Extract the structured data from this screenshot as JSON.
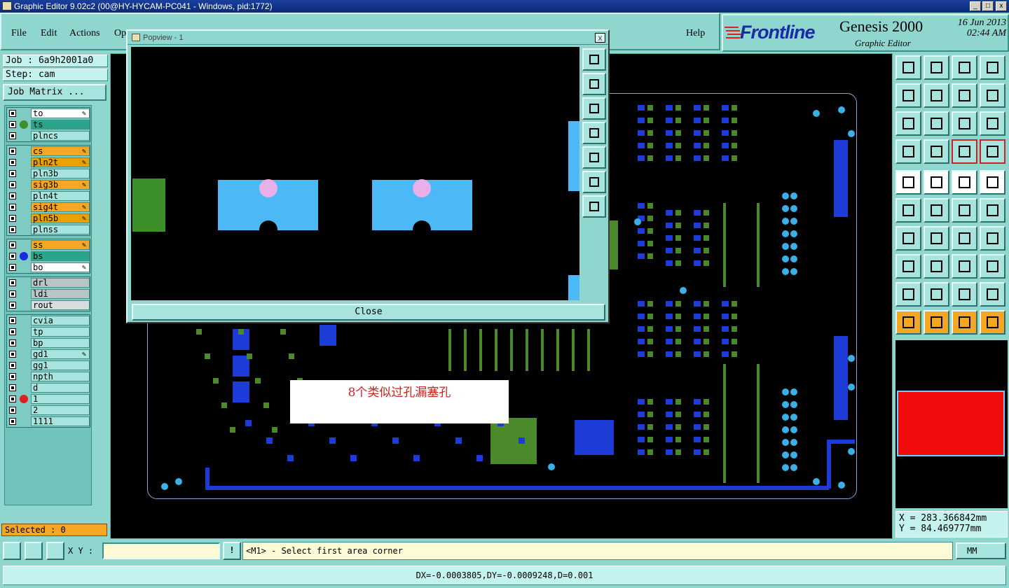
{
  "window": {
    "title": "Graphic Editor 9.02c2 (00@HY-HYCAM-PC041 - Windows, pid:1772)"
  },
  "menu": {
    "file": "File",
    "edit": "Edit",
    "actions": "Actions",
    "options": "Op",
    "help": "Help"
  },
  "brand": {
    "logo": "Frontline",
    "product": "Genesis 2000",
    "module": "Graphic Editor",
    "date": "16 Jun 2013",
    "time": "02:44 AM"
  },
  "job": {
    "job_line": "Job : 6a9h2001a0",
    "step_line": "Step: cam",
    "matrix_button": "Job Matrix ..."
  },
  "layers": [
    [
      {
        "name": "to",
        "color": "#ffffff",
        "dot": "",
        "pen": true
      },
      {
        "name": "ts",
        "color": "#2aa58a",
        "dot": "#3d8f2a",
        "pen": false
      },
      {
        "name": "plncs",
        "color": "#a7e4dd",
        "dot": "",
        "pen": false
      }
    ],
    [
      {
        "name": "cs",
        "color": "#f5a623",
        "dot": "",
        "pen": true
      },
      {
        "name": "pln2t",
        "color": "#e8a100",
        "dot": "",
        "pen": true
      },
      {
        "name": "pln3b",
        "color": "#a7e4dd",
        "dot": "",
        "pen": false
      },
      {
        "name": "sig3b",
        "color": "#f5a623",
        "dot": "",
        "pen": true
      },
      {
        "name": "pln4t",
        "color": "#a7e4dd",
        "dot": "",
        "pen": false
      },
      {
        "name": "sig4t",
        "color": "#f5a623",
        "dot": "",
        "pen": true
      },
      {
        "name": "pln5b",
        "color": "#e8a100",
        "dot": "",
        "pen": true
      },
      {
        "name": "plnss",
        "color": "#a7e4dd",
        "dot": "",
        "pen": false
      }
    ],
    [
      {
        "name": "ss",
        "color": "#f5a623",
        "dot": "",
        "pen": true
      },
      {
        "name": "bs",
        "color": "#2aa58a",
        "dot": "#1a2ae0",
        "pen": false
      },
      {
        "name": "bo",
        "color": "#ffffff",
        "dot": "",
        "pen": true
      }
    ],
    [
      {
        "name": "drl",
        "color": "#b9c4c6",
        "dot": "",
        "pen": false
      },
      {
        "name": "ldi",
        "color": "#b9c4c6",
        "dot": "",
        "pen": false
      },
      {
        "name": "rout",
        "color": "#d7dcdc",
        "dot": "",
        "pen": false
      }
    ],
    [
      {
        "name": "cvia",
        "color": "#a7e4dd",
        "dot": "",
        "pen": false
      },
      {
        "name": "tp",
        "color": "#a7e4dd",
        "dot": "",
        "pen": false
      },
      {
        "name": "bp",
        "color": "#a7e4dd",
        "dot": "",
        "pen": false
      },
      {
        "name": "gd1",
        "color": "#a7e4dd",
        "dot": "",
        "pen": true
      },
      {
        "name": "gg1",
        "color": "#a7e4dd",
        "dot": "",
        "pen": false
      },
      {
        "name": "npth",
        "color": "#a7e4dd",
        "dot": "",
        "pen": false
      },
      {
        "name": "d",
        "color": "#a7e4dd",
        "dot": "",
        "pen": false
      },
      {
        "name": "1",
        "color": "#a7e4dd",
        "dot": "#e02020",
        "pen": false
      },
      {
        "name": "2",
        "color": "#a7e4dd",
        "dot": "",
        "pen": false
      },
      {
        "name": "1111",
        "color": "#a7e4dd",
        "dot": "",
        "pen": false
      }
    ]
  ],
  "selected": "Selected : 0",
  "popup": {
    "title": "Popview - 1",
    "close_x": "x",
    "close_button": "Close"
  },
  "annotation": "8个类似过孔漏塞孔",
  "coords": {
    "x": "X = 283.366842mm",
    "y": "Y = 84.469777mm"
  },
  "bottom": {
    "xy_label": "X Y :",
    "xy_value": "",
    "message": "<M1> - Select first area corner",
    "units": "MM"
  },
  "status": "DX=-0.0003805,DY=-0.0009248,D=0.001",
  "colors": {
    "canvas": "#000000",
    "pad_cyan": "#4cb8f5",
    "hole_pink": "#e8a0e8",
    "green_pad": "#3d8f2a",
    "copper_blue": "#1d3bd6",
    "panel": "#8fd6cf"
  }
}
